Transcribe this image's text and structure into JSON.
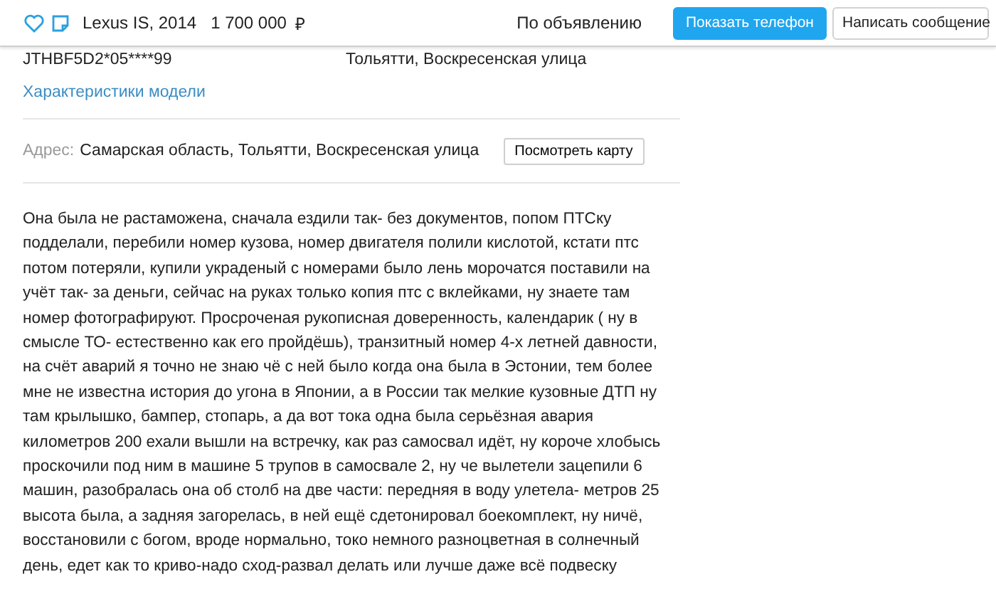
{
  "header": {
    "title": "Lexus IS, 2014",
    "price": "1 700 000",
    "currency": "₽",
    "price_note": "По объявлению",
    "buttons": [
      {
        "label": "Показать телефон",
        "kind": "primary"
      },
      {
        "label": "Написать сообщение",
        "kind": "secondary"
      }
    ]
  },
  "details": {
    "vin": "JTHBF5D2*05****99",
    "location": "Тольятти, Воскресенская улица",
    "link": "Характеристики модели"
  },
  "address": {
    "label": "Адрес:",
    "value": "Самарская область, Тольятти, Воскресенская улица",
    "map_button": "Посмотреть карту"
  },
  "description": [
    "Она была не растаможена, сначала ездили так- без документов, попом ПТСку",
    "подделали, перебили номер кузова, номер двигателя полили кислотой, кстати птс",
    "потом потеряли, купили украденый с номерами было лень морочатся поставили на",
    "учёт так- за деньги, сейчас на руках только копия птс с вклейками, ну знаете там",
    "номер фотографируют. Просроченая рукописная доверенность, календарик ( ну в",
    "смысле ТО- естественно как его пройдёшь), транзитный номер 4-х летней давности,",
    "на счёт аварий я точно не знаю чё с ней было когда она была в Эстонии, тем более",
    "мне не известна история до угона в Японии, а в России так мелкие кузовные ДТП ну",
    "там крылышко, бампер, стопарь, а да вот тока одна была серьёзная авария",
    "километров 200 ехали вышли на встречку, как раз самосвал идёт, ну короче хлобысь",
    "проскочили под ним в машине 5 трупов в самосвале 2, ну че вылетели зацепили 6",
    "машин, разобралась она об столб на две части: передняя в воду улетела- метров 25",
    "высота была, а задняя загорелась, в ней ещё сдетонировал боекомплект, ну ничё,",
    "восстановили с богом, вроде нормально, токо немного разноцветная в солнечный",
    "день, едет как то криво-надо сход-развал делать или лучше даже всё подвеску"
  ]
}
